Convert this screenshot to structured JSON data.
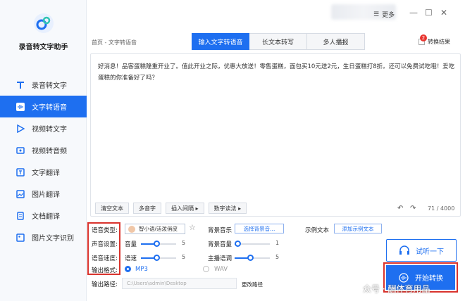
{
  "app": {
    "title": "录音转文字助手"
  },
  "sidebar": {
    "items": [
      {
        "label": "录音转文字",
        "icon": "text-icon"
      },
      {
        "label": "文字转语音",
        "icon": "waveform-icon"
      },
      {
        "label": "视频转文字",
        "icon": "video-play-icon"
      },
      {
        "label": "视频转音频",
        "icon": "video-audio-icon"
      },
      {
        "label": "文字翻译",
        "icon": "translate-icon"
      },
      {
        "label": "图片翻译",
        "icon": "image-translate-icon"
      },
      {
        "label": "文档翻译",
        "icon": "document-translate-icon"
      },
      {
        "label": "图片文字识别",
        "icon": "image-ocr-icon"
      }
    ],
    "active_index": 1
  },
  "topbar": {
    "more_label": "更多"
  },
  "breadcrumb": "首页 - 文字转语音",
  "tabs": [
    {
      "label": "输入文字转语音"
    },
    {
      "label": "长文本转写"
    },
    {
      "label": "多人播报"
    }
  ],
  "convert_result": {
    "label": "转换结果",
    "badge": "2"
  },
  "editor": {
    "text": "好消息！品客蛋糕隆重开业了。值此开业之际，优惠大放送！零售蛋糕，面包买10元送2元，生日蛋糕打8折。还可以免费试吃哦！爱吃蛋糕的你准备好了吗？",
    "char_count": "71 / 4000",
    "tools": [
      "清空文本",
      "多音字",
      "插入间隔 ▸",
      "数字读法 ▸"
    ]
  },
  "settings": {
    "voice_type_label": "语音类型:",
    "voice_name": "智小语/活泼俏皮",
    "bg_music_label": "背景音乐",
    "bg_music_button": "选择背景音...",
    "sample_text_label": "示例文本",
    "sample_text_button": "添加示例文本",
    "sound_settings_label": "声音设置:",
    "volume_label": "音量",
    "volume_value": "5",
    "bg_volume_label": "背景音量",
    "bg_volume_value": "1",
    "speed_label": "语音速度:",
    "rate_label": "语速",
    "rate_value": "5",
    "pitch_label": "主播语调",
    "pitch_value": "5",
    "format_label": "输出格式:",
    "format_mp3": "MP3",
    "format_wav": "WAV",
    "output_path_label": "输出路径:",
    "output_path": "C:\\Users\\admin\\Desktop",
    "change_path": "更改路径"
  },
  "buttons": {
    "listen": "试听一下",
    "start": "开始转换"
  },
  "watermark": "众号 · 酬体育用品",
  "colors": {
    "accent": "#1e6ff0",
    "highlight": "#d9332d"
  }
}
